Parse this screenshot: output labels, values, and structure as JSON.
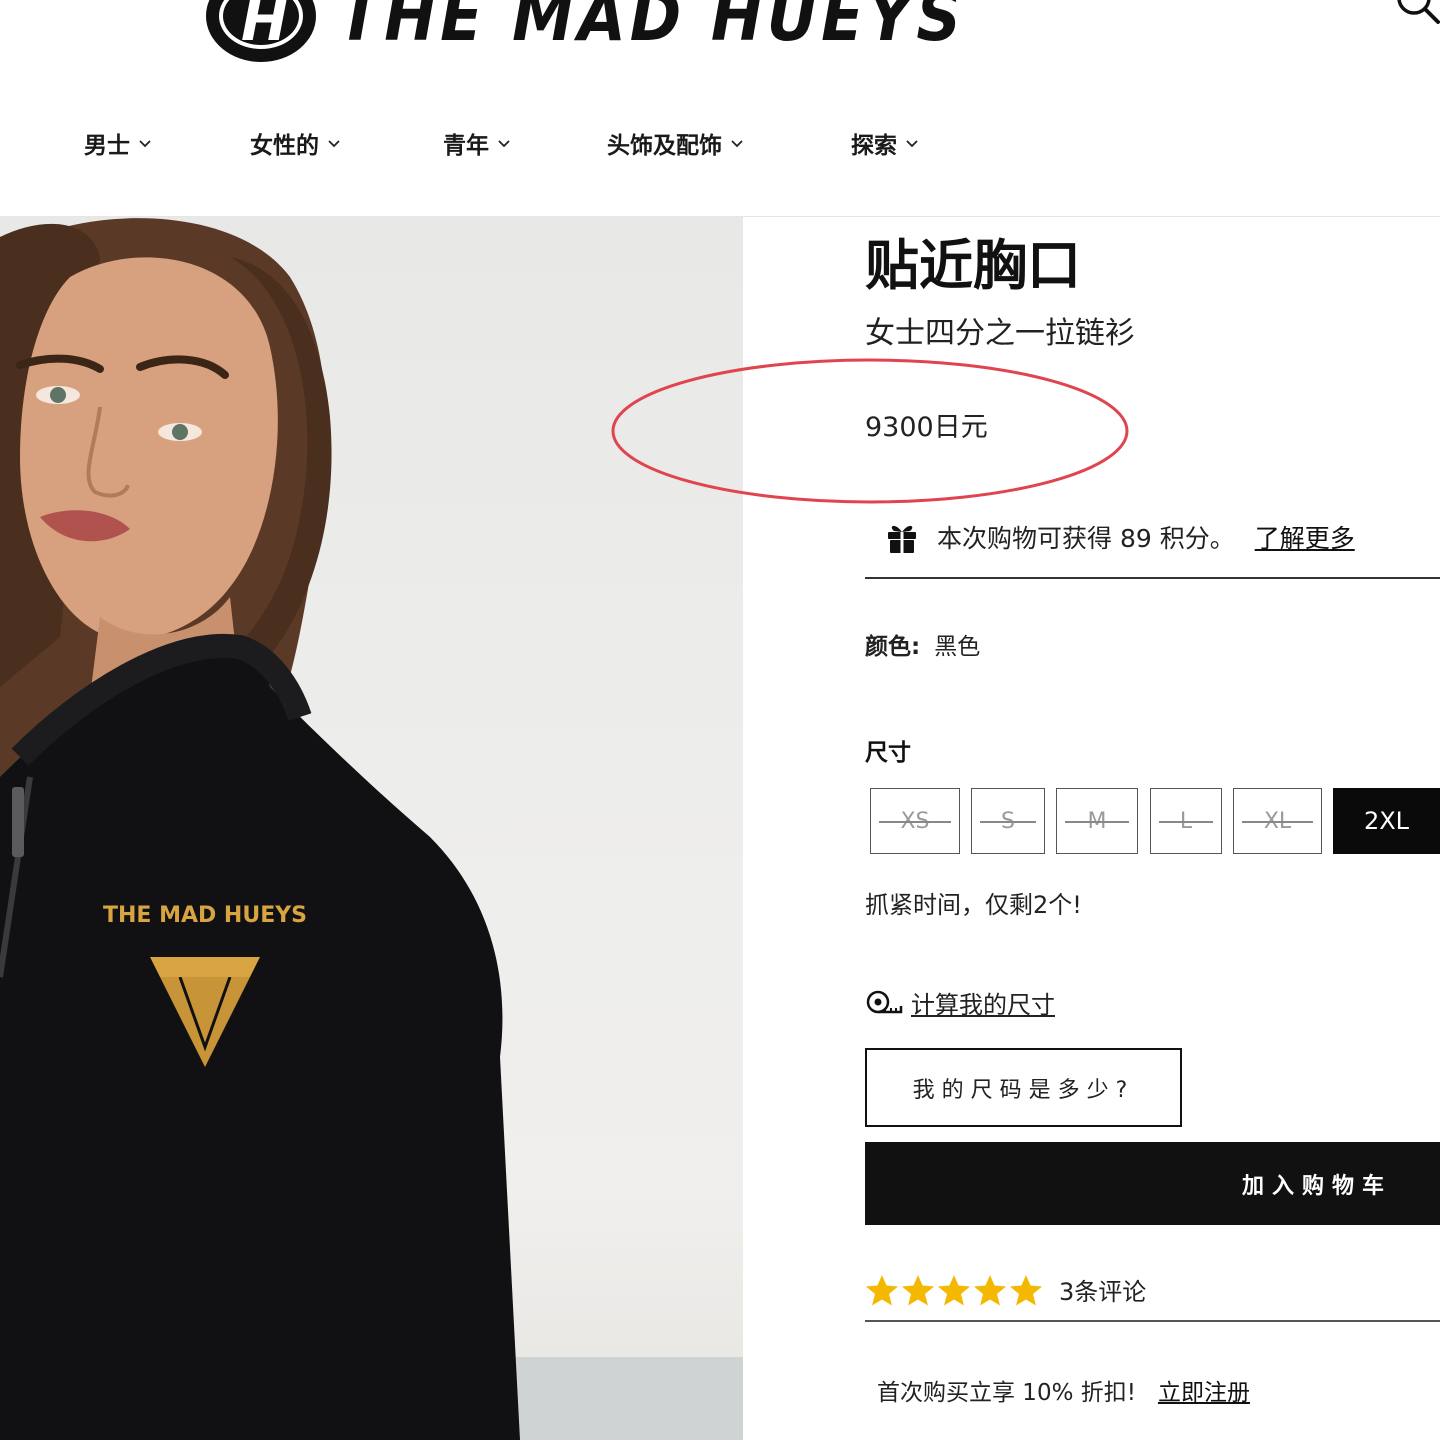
{
  "header": {
    "logo_text": "THE MAD HUEYS",
    "nav": [
      {
        "label": "男士"
      },
      {
        "label": "女性的"
      },
      {
        "label": "青年"
      },
      {
        "label": "头饰及配饰"
      },
      {
        "label": "探索"
      }
    ]
  },
  "product": {
    "title": "贴近胸口",
    "subtitle": "女士四分之一拉链衫",
    "price": "9300日元",
    "points_text": "本次购物可获得 89 积分。",
    "points_link": "了解更多",
    "color_label": "颜色:",
    "color_value": "黑色",
    "size_label": "尺寸",
    "sizes": [
      {
        "label": "XS",
        "available": false
      },
      {
        "label": "S",
        "available": false
      },
      {
        "label": "M",
        "available": false
      },
      {
        "label": "L",
        "available": false
      },
      {
        "label": "XL",
        "available": false
      },
      {
        "label": "2XL",
        "available": true,
        "selected": true
      }
    ],
    "stock_note": "抓紧时间，仅剩2个!",
    "calc_size_link": "计算我的尺寸",
    "what_size_button": "我的尺码是多少?",
    "add_to_cart": "加入购物车",
    "rating": 5,
    "reviews_count": "3条评论",
    "promo_text": "首次购买立享 10% 折扣!",
    "promo_link": "立即注册"
  },
  "hero": {
    "chest_logo": "THE MAD HUEYS"
  },
  "colors": {
    "accent_black": "#111111",
    "highlight_red": "#e0454f",
    "star_yellow": "#f5b800",
    "logo_gold": "#d7a441"
  }
}
